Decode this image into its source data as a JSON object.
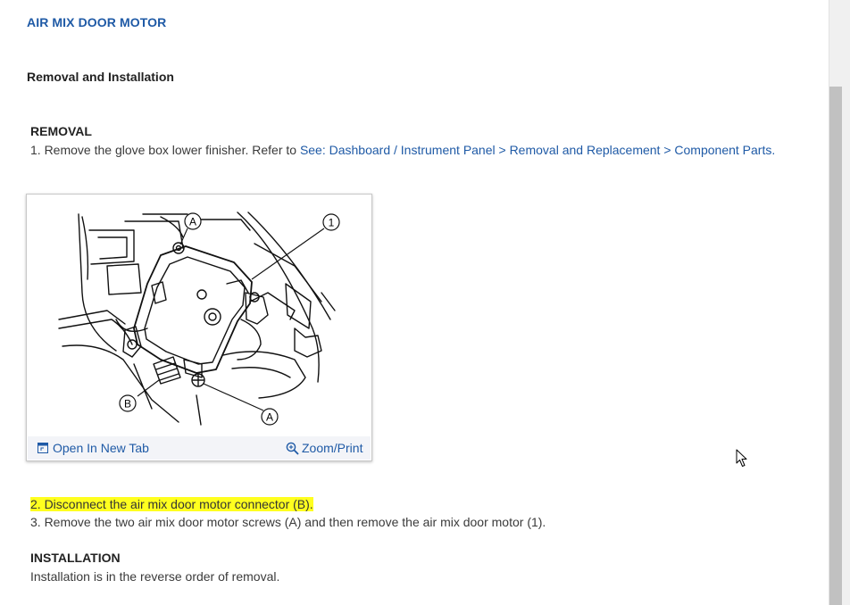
{
  "page": {
    "title": "AIR MIX DOOR MOTOR",
    "subtitle": "Removal and Installation"
  },
  "removal": {
    "heading": "REMOVAL",
    "step1_text": "1. Remove the glove box lower finisher. Refer to ",
    "step1_link": "See: Dashboard / Instrument Panel > Removal and Replacement > Component Parts."
  },
  "figure": {
    "callouts": [
      "A",
      "1",
      "B",
      "A"
    ],
    "open_tab_label": "Open In New Tab",
    "zoom_label": "Zoom/Print",
    "icons": [
      "open-tab-icon",
      "zoom-icon"
    ]
  },
  "steps": {
    "step2": "2. Disconnect the air mix door motor connector (B).",
    "step3": "3. Remove the two air mix door motor screws (A) and then remove the air mix door motor (1)."
  },
  "installation": {
    "heading": "INSTALLATION",
    "text": "Installation is in the reverse order of removal."
  },
  "colors": {
    "link": "#1f5aa6",
    "highlight": "#ffff1f",
    "scroll_thumb": "#c1c1c1"
  }
}
